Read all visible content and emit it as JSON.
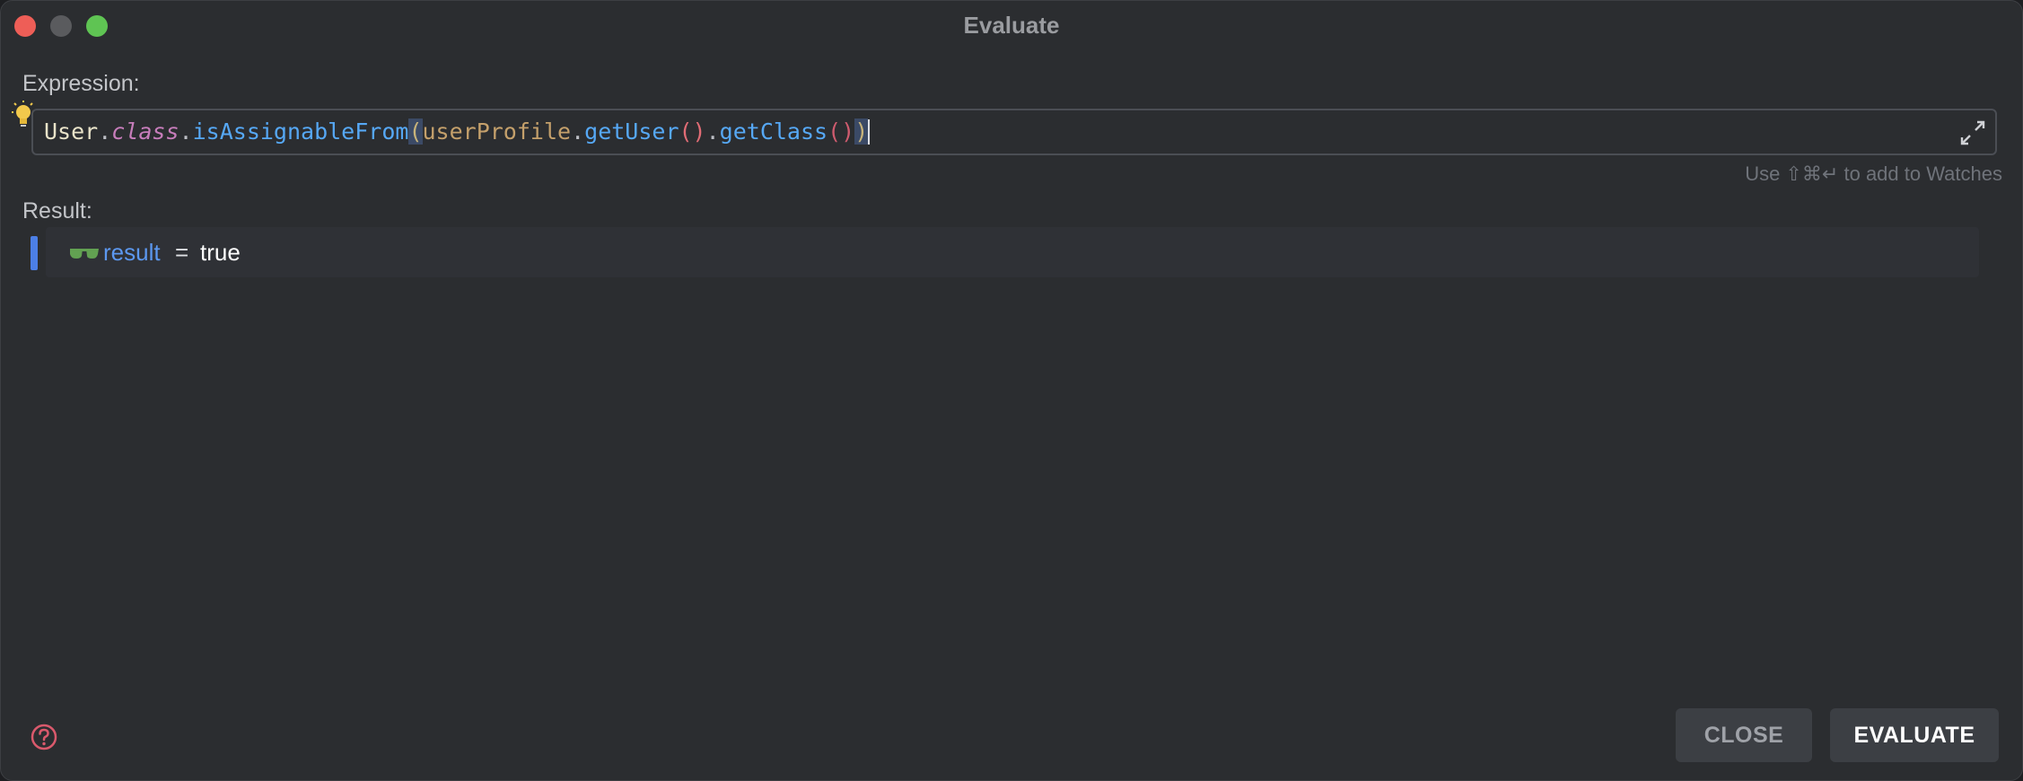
{
  "window": {
    "title": "Evaluate"
  },
  "expression": {
    "label": "Expression:",
    "tokens": {
      "t1": "User",
      "t2": ".",
      "t3": "class",
      "t4": ".",
      "t5": "isAssignableFrom",
      "t6": "(",
      "t7": "userProfile",
      "t8": ".",
      "t9": "getUser",
      "t10": "()",
      "t11": ".",
      "t12": "getClass",
      "t13": "()",
      "t14": ")"
    },
    "hint": "Use ⇧⌘↵ to add to Watches"
  },
  "result": {
    "label": "Result:",
    "name": "result",
    "equals": "=",
    "value": "true"
  },
  "buttons": {
    "close": "CLOSE",
    "evaluate": "EVALUATE"
  },
  "colors": {
    "accent": "#4c7fe6",
    "background": "#2b2d30"
  }
}
